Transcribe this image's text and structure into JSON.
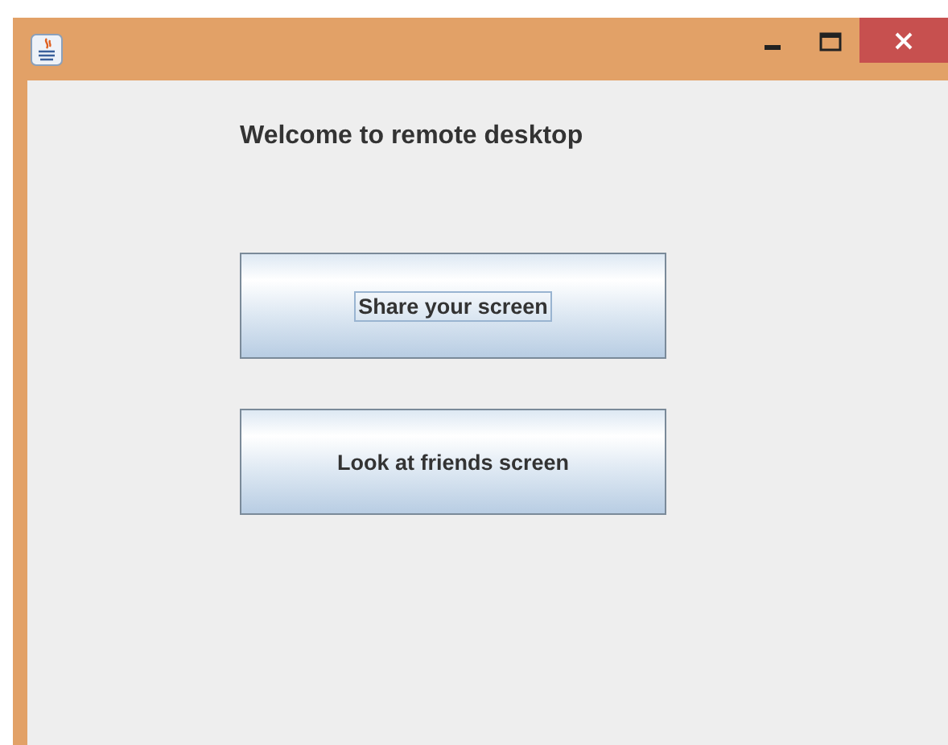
{
  "window": {
    "heading": "Welcome to remote desktop"
  },
  "buttons": [
    {
      "label": "Share your screen",
      "focused": true
    },
    {
      "label": "Look at friends screen",
      "focused": false
    }
  ]
}
